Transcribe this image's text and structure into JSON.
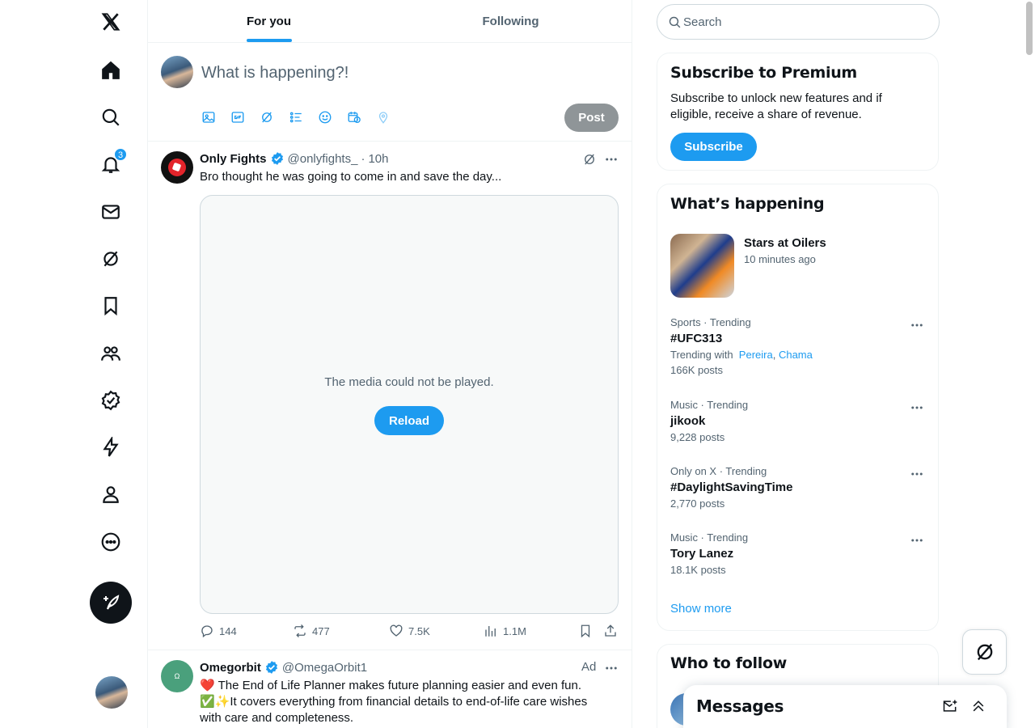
{
  "nav": {
    "notifications_badge": "3",
    "items": [
      "x-logo",
      "home",
      "explore",
      "notifications",
      "messages",
      "grok",
      "bookmarks",
      "communities",
      "premium",
      "verified-orgs",
      "profile",
      "more"
    ]
  },
  "tabs": [
    {
      "label": "For you",
      "active": true
    },
    {
      "label": "Following",
      "active": false
    }
  ],
  "composer": {
    "placeholder": "What is happening?!",
    "post_label": "Post"
  },
  "tweets": [
    {
      "name": "Only Fights",
      "handle": "@onlyfights_",
      "dot": "·",
      "time": "10h",
      "text": "Bro thought he was going to come in and save the day...",
      "media_message": "The media could not be played.",
      "reload_label": "Reload",
      "stats": {
        "replies": "144",
        "reposts": "477",
        "likes": "7.5K",
        "views": "1.1M"
      }
    },
    {
      "name": "Omegorbit",
      "handle": "@OmegaOrbit1",
      "ad_label": "Ad",
      "line1": "❤️ The End of Life Planner makes future planning easier and even fun.",
      "line2": "✅✨It covers everything from financial details to end-of-life care wishes",
      "line3": "with care and completeness."
    }
  ],
  "search": {
    "placeholder": "Search"
  },
  "premium": {
    "title": "Subscribe to Premium",
    "text": "Subscribe to unlock new features and if eligible, receive a share of revenue.",
    "button": "Subscribe"
  },
  "happening": {
    "title": "What’s happening",
    "event": {
      "title": "Stars at Oilers",
      "time": "10 minutes ago"
    },
    "trends": [
      {
        "meta": "Sports · Trending",
        "name": "#UFC313",
        "with_label": "Trending with",
        "with_links": [
          "Pereira",
          "Chama"
        ],
        "count": "166K posts"
      },
      {
        "meta": "Music · Trending",
        "name": "jikook",
        "count": "9,228 posts"
      },
      {
        "meta": "Only on X · Trending",
        "name": "#DaylightSavingTime",
        "count": "2,770 posts"
      },
      {
        "meta": "Music · Trending",
        "name": "Tory Lanez",
        "count": "18.1K posts"
      }
    ],
    "show_more": "Show more"
  },
  "who_to_follow": {
    "title": "Who to follow"
  },
  "messages": {
    "title": "Messages"
  },
  "colors": {
    "accent": "#1d9bf0",
    "text": "#0f1419",
    "muted": "#536471",
    "border": "#eff3f4"
  }
}
